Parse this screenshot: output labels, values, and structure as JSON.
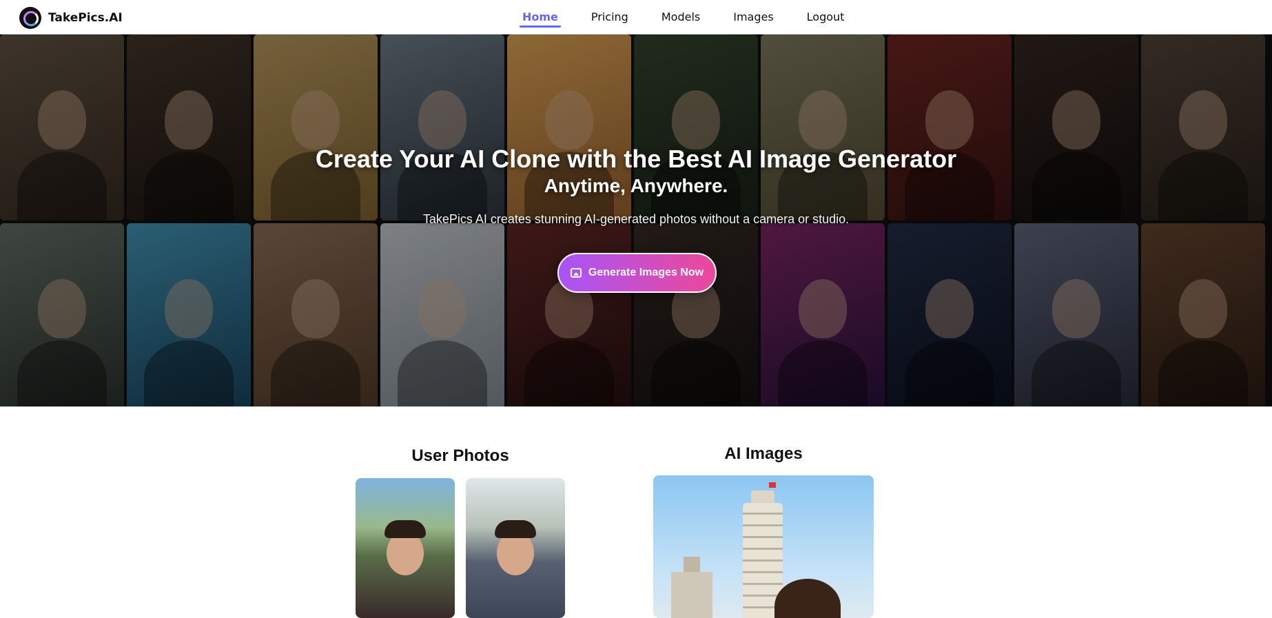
{
  "brand": {
    "name": "TakePics.AI"
  },
  "nav": {
    "items": [
      {
        "label": "Home",
        "active": true
      },
      {
        "label": "Pricing",
        "active": false
      },
      {
        "label": "Models",
        "active": false
      },
      {
        "label": "Images",
        "active": false
      },
      {
        "label": "Logout",
        "active": false
      }
    ]
  },
  "hero": {
    "title": "Create Your AI Clone with the Best AI Image Generator",
    "subtitle": "Anytime, Anywhere.",
    "description": "TakePics AI creates stunning AI-generated photos without a camera or studio.",
    "cta_label": "Generate Images Now"
  },
  "sections": {
    "user_photos_title": "User Photos",
    "ai_images_title": "AI Images"
  },
  "colors": {
    "accent": "#6366f1",
    "cta_start": "#a855f7",
    "cta_end": "#ec4899"
  }
}
